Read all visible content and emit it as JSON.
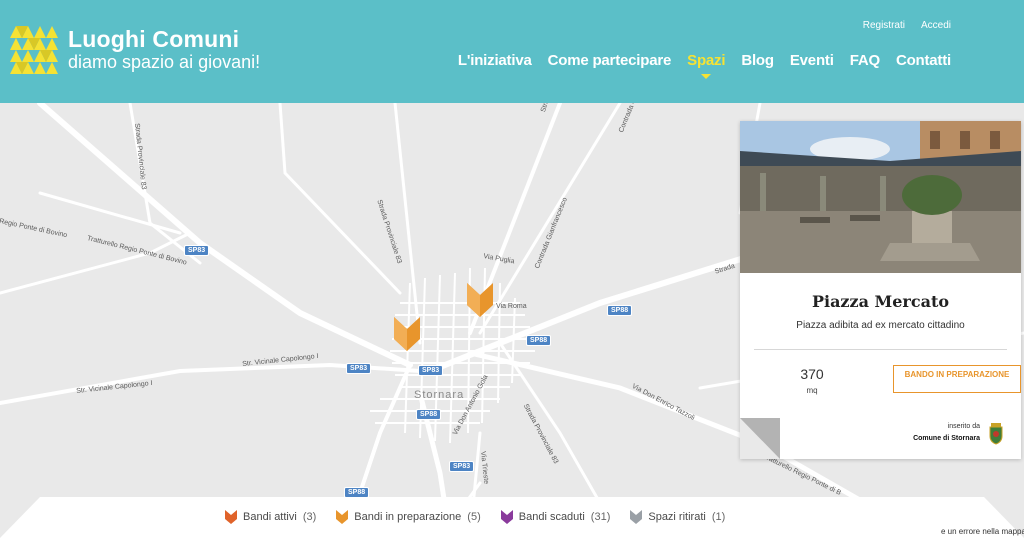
{
  "header": {
    "logo_title": "Luoghi Comuni",
    "logo_subtitle": "diamo spazio ai giovani!",
    "top_links": {
      "register": "Registrati",
      "login": "Accedi"
    },
    "nav": {
      "initiative": "L'iniziativa",
      "how": "Come partecipare",
      "spaces": "Spazi",
      "blog": "Blog",
      "events": "Eventi",
      "faq": "FAQ",
      "contacts": "Contatti"
    },
    "active_nav": "Spazi",
    "colors": {
      "header_bg": "#5bbfc8",
      "accent": "#f5e234"
    }
  },
  "map": {
    "town": "Stornara",
    "road_labels": {
      "sp83_a": "SP83",
      "sp83_b": "SP83",
      "sp83_c": "SP83",
      "sp83_d": "SP83",
      "sp88_a": "SP88",
      "sp88_b": "SP88",
      "sp88_c": "SP88",
      "sp88_d": "SP88",
      "ponte_bovino_1": "Regio Ponte di Bovino",
      "ponte_bovino_2": "Tratturello Regio Ponte di Bovino",
      "capolongo_1": "Str. Vicinale Capolongo I",
      "capolongo_2": "Str. Vicinale Capolongo I",
      "provinciale_83": "Strada Provinciale 83",
      "provinciale_83_b": "Strada Provinciale 83",
      "provinciale_83_c": "Strada Provinciale 83",
      "gianfrancesco": "Contrada Gianfrancesco",
      "via_puglia": "Via Puglia",
      "via_roma": "Via Roma",
      "enrico_tazzoli": "Via Don Enrico Tazzoli",
      "tratturello_ponte": "Tratturello Regio Ponte di B",
      "antonio_gola": "Via Don Antonio Gola",
      "via_trieste": "Via Trieste",
      "strada_com": "Strada Com",
      "strada_side": "Strada"
    },
    "pin_icon": "fox-pin-icon"
  },
  "card": {
    "title": "Piazza Mercato",
    "description": "Piazza adibita ad ex mercato cittadino",
    "size_value": "370",
    "size_unit": "mq",
    "status": "BANDO IN PREPARAZIONE",
    "inserted_label": "inserito da",
    "inserted_by": "Comune di Stornara",
    "crest_icon": "municipal-crest-icon"
  },
  "legend": {
    "active_label": "Bandi attivi",
    "active_count": "(3)",
    "active_color": "#e0632a",
    "prep_label": "Bandi in preparazione",
    "prep_count": "(5)",
    "prep_color": "#e8952c",
    "expired_label": "Bandi scaduti",
    "expired_count": "(31)",
    "expired_color": "#8a3a9c",
    "withdrawn_label": "Spazi ritirati",
    "withdrawn_count": "(1)",
    "withdrawn_color": "#9aa0a6"
  },
  "report_error": "e un errore nella mappa"
}
